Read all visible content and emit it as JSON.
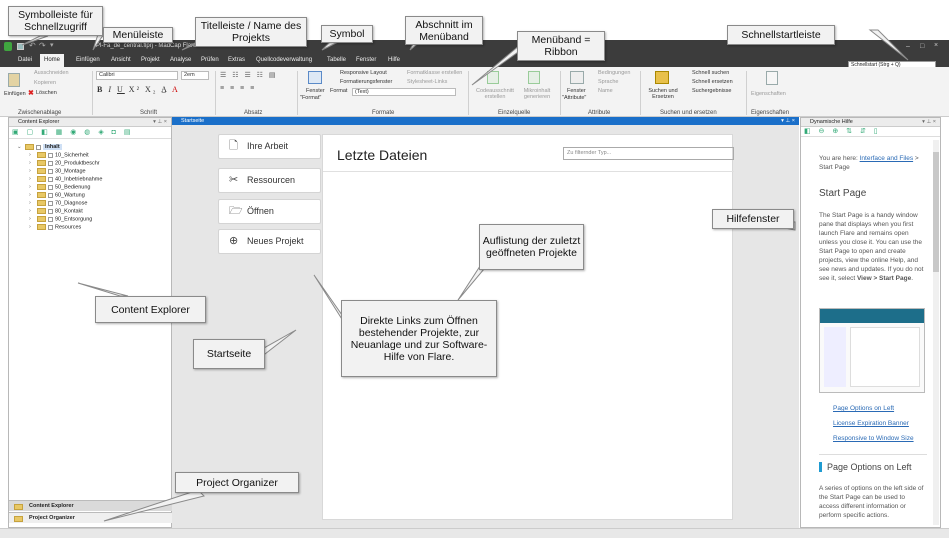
{
  "window": {
    "title": "Pl-Fa_de_central.flprj - MadCap Flare",
    "minimize": "–",
    "maximize": "□",
    "close": "×"
  },
  "menu": [
    "Datei",
    "Home",
    "Einfügen",
    "Ansicht",
    "Projekt",
    "Analyse",
    "Prüfen",
    "Extras",
    "Quellcodeverwaltung",
    "Tabelle",
    "Fenster",
    "Hilfe"
  ],
  "menu_active": "Home",
  "quick_search": "Schnellstart (Strg + Q)",
  "ribbon": {
    "clipboard": {
      "paste": "Einfügen",
      "cut": "Ausschneiden",
      "copy": "Kopieren",
      "delete": "Löschen",
      "label": "Zwischenablage"
    },
    "font": {
      "family": "Calibri",
      "size": "2em",
      "label": "Schrift"
    },
    "paragraph": {
      "label": "Absatz"
    },
    "format": {
      "window": "Fenster",
      "window2": "\"Format\"",
      "responsive": "Responsive Layout",
      "formatting": "Formatierungsfenster",
      "format_label": "Format",
      "format_value": "(Text)",
      "stylesheet": "Stylesheet-Links",
      "class_create": "Formatklasse erstellen",
      "label": "Formate"
    },
    "source": {
      "code_create": "Codeausschnitt erstellen",
      "micro": "Mikroinhalt generieren",
      "label": "Einzelquelle"
    },
    "attributes": {
      "window": "Fenster",
      "window2": "\"Attribute\"",
      "conditions": "Bedingungen",
      "language": "Sprache",
      "name": "Name",
      "label": "Attribute"
    },
    "search": {
      "search_replace": "Suchen und Ersetzen",
      "quick_find": "Schnell suchen",
      "quick_replace": "Schnell ersetzen",
      "results": "Suchergebnisse",
      "label": "Suchen und ersetzen"
    },
    "props": {
      "label": "Eigenschaften",
      "btn": "Eigenschaften"
    }
  },
  "content_explorer": {
    "header": "Content Explorer",
    "root": "Inhalt",
    "items": [
      "10_Sicherheit",
      "20_Produktbeschr",
      "30_Montage",
      "40_Inbetriebnahme",
      "50_Bedienung",
      "60_Wartung",
      "70_Diagnose",
      "80_Kontakt",
      "90_Entsorgung",
      "Resources"
    ],
    "tab1": "Content Explorer",
    "tab2": "Project Organizer"
  },
  "start": {
    "header": "Startseite",
    "nav": [
      "Ihre Arbeit",
      "Ressourcen",
      "Öffnen",
      "Neues Projekt"
    ],
    "title": "Letzte Dateien",
    "filter_placeholder": "Zu filternder Typ..."
  },
  "help": {
    "header": "Dynamische Hilfe",
    "breadcrumb_pre": "You are here: ",
    "breadcrumb_link": "Interface and Files",
    "breadcrumb_post": " > Start Page",
    "title": "Start Page",
    "body1": "The Start Page is a handy window pane that displays when you first launch Flare and remains open unless you close it. You can use the Start Page to open and create projects, view the online Help, and see news and updates. If you do not see it, select ",
    "body1_bold": "View > Start Page",
    "body1_end": ".",
    "links": [
      "Page Options on Left",
      "License Expiration Banner",
      "Responsive to Window Size"
    ],
    "h2": "Page Options on Left",
    "body2": "A series of options on the left side of the Start Page can be used to access different information or perform specific actions."
  },
  "callouts": {
    "quick_access": "Symbolleiste für Schnellzugriff",
    "menu_bar": "Menüleiste",
    "title_bar": "Titelleiste / Name des Projekts",
    "symbol": "Symbol",
    "ribbon_section": "Abschnitt im Menüband",
    "ribbon": "Menüband = Ribbon",
    "quick_launch": "Schnellstartleiste",
    "help_window": "Hilfefenster",
    "recent": "Auflistung der zuletzt geöffneten Projekte",
    "links": "Direkte Links zum Öffnen bestehender Projekte, zur Neuanlage und zur Software-Hilfe von Flare.",
    "content_explorer": "Content Explorer",
    "start_page": "Startseite",
    "project_organizer": "Project Organizer"
  }
}
